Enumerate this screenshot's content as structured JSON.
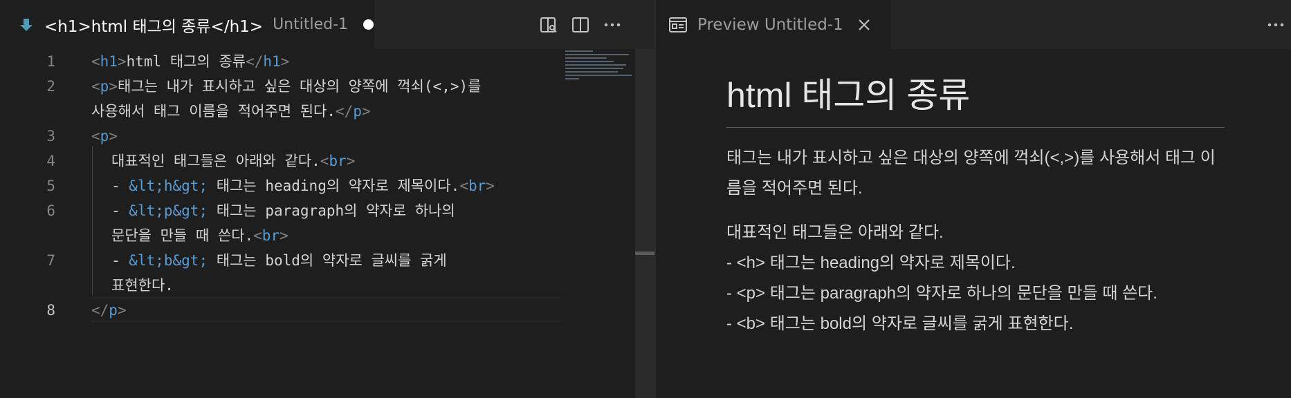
{
  "editor": {
    "tab": {
      "title": "<h1>html 태그의 종류</h1>",
      "description": "Untitled-1",
      "icon": "markdown-down-arrow-icon",
      "dirty": true
    },
    "actions": [
      "open-preview-icon",
      "split-editor-icon",
      "more-actions-icon"
    ],
    "line_numbers": [
      "1",
      "2",
      "",
      "3",
      "4",
      "5",
      "6",
      "",
      "7",
      "",
      "8"
    ],
    "active_line": "8",
    "lines": {
      "l1": {
        "o": "<",
        "tag": "h1",
        "c": ">",
        "text": "html 태그의 종류",
        "o2": "</",
        "tag2": "h1",
        "c2": ">"
      },
      "l2": {
        "o": "<",
        "tag": "p",
        "c": ">",
        "text": "태그는 내가 표시하고 싶은 대상의 양쪽에 꺽쇠(<,>)를"
      },
      "l2b": {
        "text": "사용해서 태그 이름을 적어주면 된다.",
        "o2": "</",
        "tag2": "p",
        "c2": ">"
      },
      "l3": {
        "o": "<",
        "tag": "p",
        "c": ">"
      },
      "l4": {
        "text": "대표적인 태그들은 아래와 같다.",
        "o2": "<",
        "tag2": "br",
        "c2": ">"
      },
      "l5": {
        "dash": "- ",
        "ent": "&lt;h&gt;",
        "text": " 태그는 heading의 약자로 제목이다.",
        "o2": "<",
        "tag2": "br",
        "c2": ">"
      },
      "l6": {
        "dash": "- ",
        "ent": "&lt;p&gt;",
        "text": " 태그는 paragraph의 약자로 하나의"
      },
      "l6b": {
        "text": "문단을 만들 때 쓴다.",
        "o2": "<",
        "tag2": "br",
        "c2": ">"
      },
      "l7": {
        "dash": "- ",
        "ent": "&lt;b&gt;",
        "text": " 태그는 bold의 약자로 글씨를 굵게"
      },
      "l7b": {
        "text": "표현한다."
      },
      "l8": {
        "o": "</",
        "tag": "p",
        "c": ">"
      }
    }
  },
  "preview": {
    "tab": {
      "title": "Preview Untitled-1",
      "icon": "preview-icon",
      "close": "close-icon"
    },
    "more": "more-actions-icon",
    "h1": "html 태그의 종류",
    "p1": "태그는 내가 표시하고 싶은 대상의 양쪽에 꺽쇠(<,>)를 사용해서 태그 이름을 적어주면 된다.",
    "p2_lines": [
      "대표적인 태그들은 아래와 같다.",
      "- <h> 태그는 heading의 약자로 제목이다.",
      "- <p> 태그는 paragraph의 약자로 하나의 문단을 만들 때 쓴다.",
      "- <b> 태그는 bold의 약자로 글씨를 굵게 표현한다."
    ]
  },
  "colors": {
    "background": "#1e1e1e",
    "tag": "#569cd6",
    "punctuation": "#808080",
    "text": "#d4d4d4",
    "line_number": "#858585",
    "markdown_icon": "#519aba"
  }
}
